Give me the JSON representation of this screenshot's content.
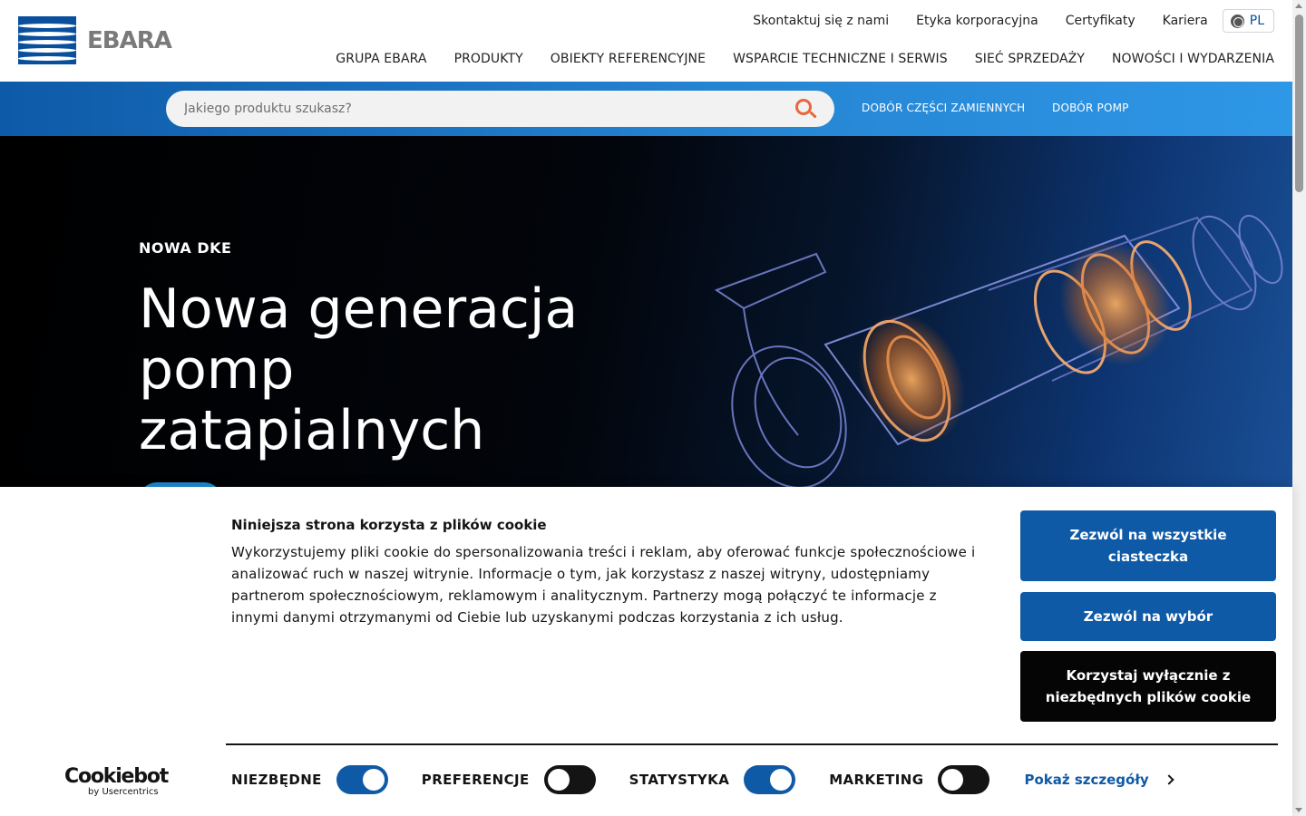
{
  "header": {
    "logo_text": "EBARA",
    "top_links": [
      "Skontaktuj się z nami",
      "Etyka korporacyjna",
      "Certyfikaty",
      "Kariera"
    ],
    "language": "PL",
    "nav": [
      "GRUPA EBARA",
      "PRODUKTY",
      "OBIEKTY REFERENCYJNE",
      "WSPARCIE TECHNICZNE I SERWIS",
      "SIEĆ SPRZEDAŻY",
      "NOWOŚCI I WYDARZENIA"
    ]
  },
  "search": {
    "placeholder": "Jakiego produktu szukasz?",
    "value": "",
    "links": [
      "DOBÓR CZĘŚCI ZAMIENNYCH",
      "DOBÓR POMP"
    ]
  },
  "hero": {
    "eyebrow": "NOWA DKE",
    "title": "Nowa generacja pomp zatapialnych"
  },
  "cookie_banner": {
    "title": "Niniejsza strona korzysta z plików cookie",
    "text": "Wykorzystujemy pliki cookie do spersonalizowania treści i reklam, aby oferować funkcje społecznościowe i analizować ruch w naszej witrynie. Informacje o tym, jak korzystasz z naszej witryny, udostępniamy partnerom społecznościowym, reklamowym i analitycznym. Partnerzy mogą połączyć te informacje z innymi danymi otrzymanymi od Ciebie lub uzyskanymi podczas korzystania z ich usług.",
    "buttons": {
      "allow_all": "Zezwól na wszystkie ciasteczka",
      "allow_selection": "Zezwól na wybór",
      "necessary_only": "Korzystaj wyłącznie z niezbędnych plików cookie"
    },
    "brand": "Cookiebot",
    "brand_sub": "by Usercentrics",
    "toggles": [
      {
        "label": "NIEZBĘDNE",
        "on": true
      },
      {
        "label": "PREFERENCJE",
        "on": false
      },
      {
        "label": "STATYSTYKA",
        "on": true
      },
      {
        "label": "MARKETING",
        "on": false
      }
    ],
    "details_link": "Pokaż szczegóły"
  },
  "colors": {
    "brand_blue": "#0f5aa6",
    "search_accent": "#e8673a",
    "text_dark": "#141414"
  }
}
